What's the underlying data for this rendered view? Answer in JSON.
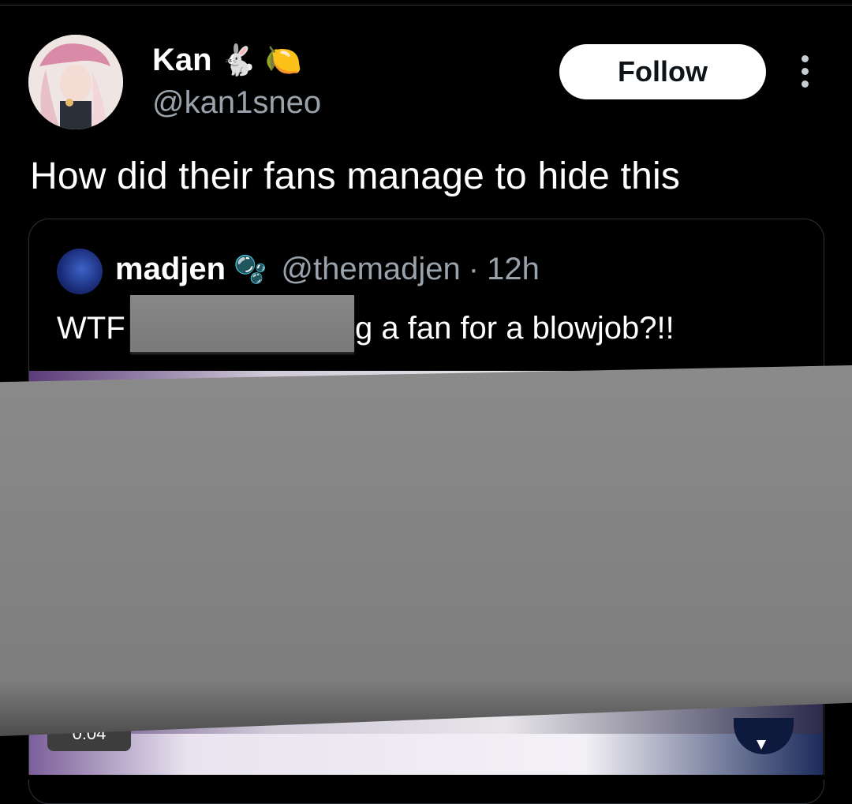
{
  "tweet": {
    "author": {
      "display_name": "Kan",
      "emojis": [
        "🐇",
        "🍋"
      ],
      "handle": "@kan1sneo"
    },
    "follow_label": "Follow",
    "text": "How did their fans manage to hide this"
  },
  "quoted_tweet": {
    "author": {
      "display_name": "madjen",
      "emoji": "🫧",
      "handle": "@themadjen",
      "separator": "·",
      "time": "12h"
    },
    "text_prefix": "WTF",
    "text_suffix": "g a fan for a blowjob?!!",
    "media": {
      "duration": "0:04"
    }
  },
  "colors": {
    "background": "#000000",
    "text": "#ffffff",
    "secondary_text": "#9aa3ab",
    "redaction": "#808080"
  },
  "icons": {
    "more": "more-vertical-icon",
    "mute": "mute-icon"
  }
}
